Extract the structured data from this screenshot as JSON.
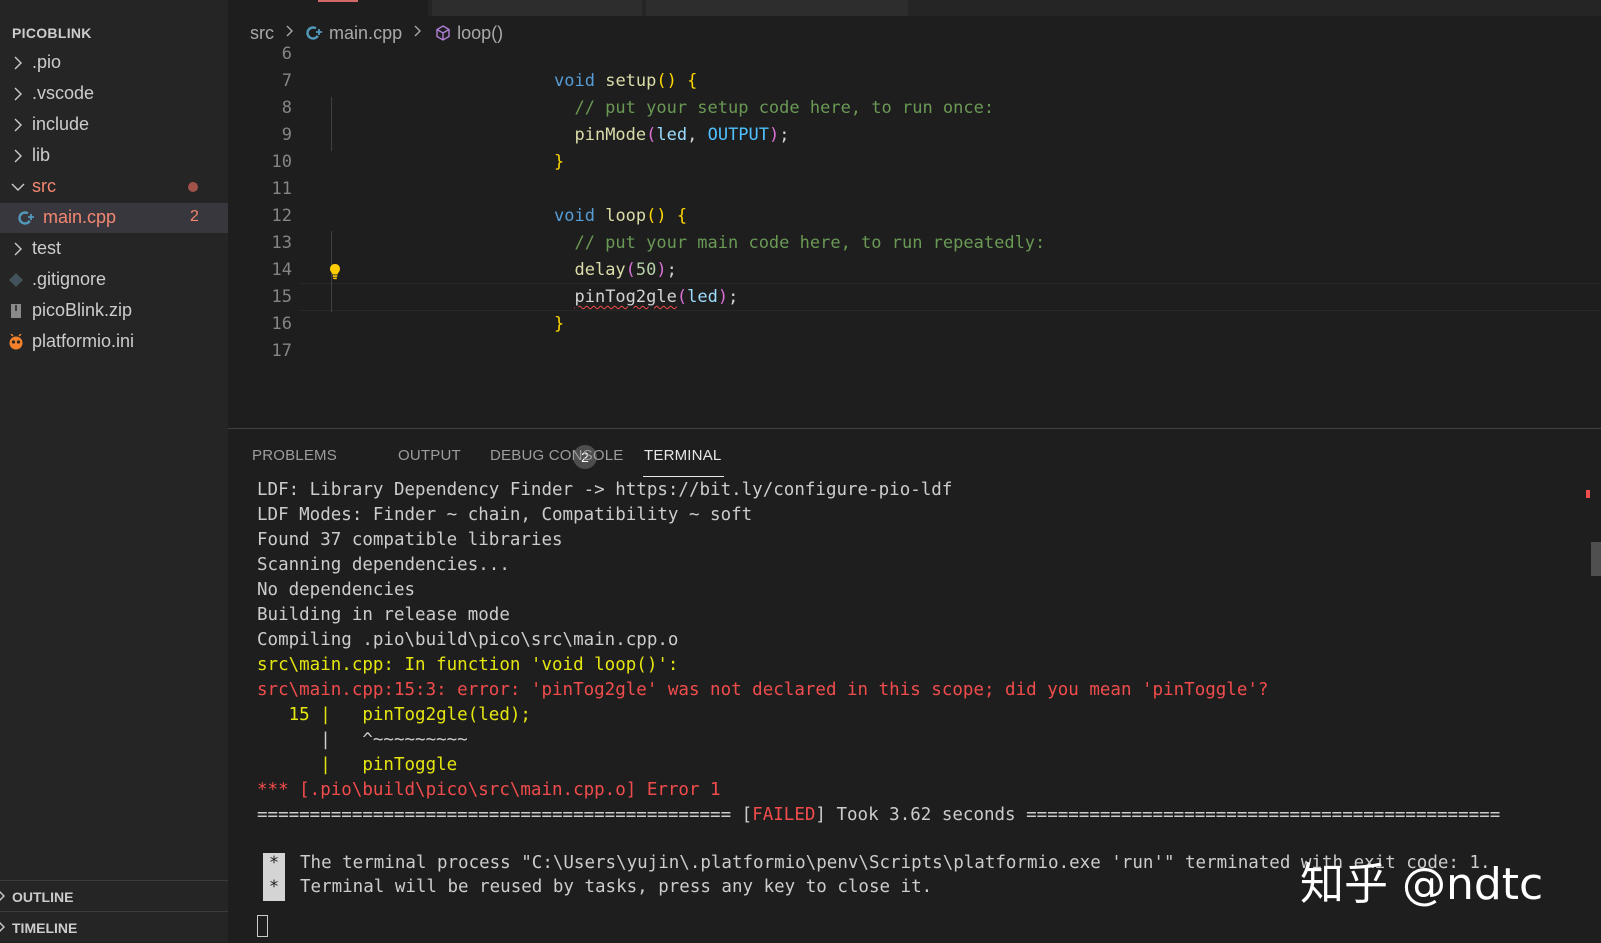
{
  "sidebar": {
    "project": "PICOBLINK",
    "items": [
      {
        "label": ".pio",
        "kind": "folder",
        "expanded": false
      },
      {
        "label": ".vscode",
        "kind": "folder",
        "expanded": false
      },
      {
        "label": "include",
        "kind": "folder",
        "expanded": false
      },
      {
        "label": "lib",
        "kind": "folder",
        "expanded": false
      },
      {
        "label": "src",
        "kind": "folder",
        "expanded": true,
        "color": "#f48771"
      },
      {
        "label": "main.cpp",
        "kind": "file",
        "badge": "2",
        "color": "#f48771",
        "selected": true
      },
      {
        "label": "test",
        "kind": "folder",
        "expanded": false
      },
      {
        "label": ".gitignore",
        "kind": "file"
      },
      {
        "label": "picoBlink.zip",
        "kind": "file"
      },
      {
        "label": "platformio.ini",
        "kind": "file"
      }
    ],
    "outline": "OUTLINE",
    "timeline": "TIMELINE"
  },
  "breadcrumb": {
    "folder": "src",
    "file": "main.cpp",
    "symbol": "loop()"
  },
  "editor": {
    "lines": [
      {
        "n": "6",
        "code": ""
      },
      {
        "n": "7",
        "code": "void setup() {"
      },
      {
        "n": "8",
        "code": "  // put your setup code here, to run once:"
      },
      {
        "n": "9",
        "code": "  pinMode(led, OUTPUT);"
      },
      {
        "n": "10",
        "code": "}"
      },
      {
        "n": "11",
        "code": ""
      },
      {
        "n": "12",
        "code": "void loop() {"
      },
      {
        "n": "13",
        "code": "  // put your main code here, to run repeatedly:"
      },
      {
        "n": "14",
        "code": "  delay(50);"
      },
      {
        "n": "15",
        "code": "  pinTog2gle(led);"
      },
      {
        "n": "16",
        "code": "}"
      },
      {
        "n": "17",
        "code": ""
      }
    ]
  },
  "panel": {
    "tabs": {
      "problems": "PROBLEMS",
      "problems_count": "2",
      "output": "OUTPUT",
      "debug_console": "DEBUG CONSOLE",
      "terminal": "TERMINAL"
    },
    "terminal": {
      "l1": "LDF: Library Dependency Finder -> https://bit.ly/configure-pio-ldf",
      "l2": "LDF Modes: Finder ~ chain, Compatibility ~ soft",
      "l3": "Found 37 compatible libraries",
      "l4": "Scanning dependencies...",
      "l5": "No dependencies",
      "l6": "Building in release mode",
      "l7": "Compiling .pio\\build\\pico\\src\\main.cpp.o",
      "l8": "src\\main.cpp: In function 'void loop()':",
      "l9": "src\\main.cpp:15:3: error: 'pinTog2gle' was not declared in this scope; did you mean 'pinToggle'?",
      "l10": "   15 |   pinTog2gle(led);",
      "l11": "      |   ^~~~~~~~~~",
      "l12": "      |   pinToggle",
      "l13": "*** [.pio\\build\\pico\\src\\main.cpp.o] Error 1",
      "l14_left": "============================================= [",
      "l14_failed": "FAILED",
      "l14_right": "] Took 3.62 seconds =============================================",
      "l15_star": "*",
      "l15": "The terminal process \"C:\\Users\\yujin\\.platformio\\penv\\Scripts\\platformio.exe 'run'\" terminated with exit code: 1.",
      "l16_star": "*",
      "l16": "Terminal will be reused by tasks, press any key to close it."
    }
  },
  "watermark": "知乎 @ndtc",
  "colors": {
    "error": "#f14c4c",
    "warning_yellow": "#e5e510",
    "modified_file": "#f48771",
    "keyword": "#569cd6",
    "function": "#dcdcaa",
    "comment": "#6a9955"
  }
}
